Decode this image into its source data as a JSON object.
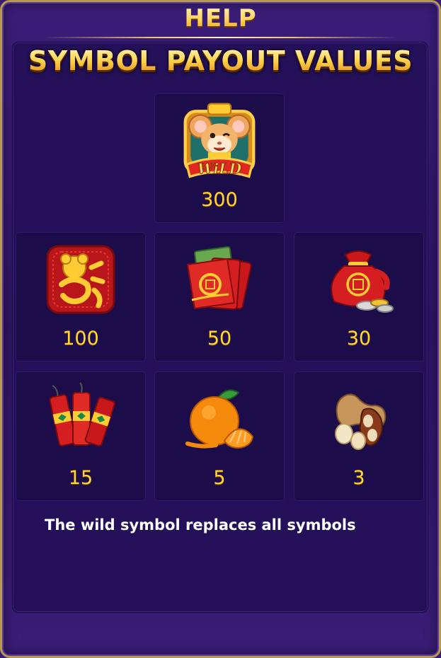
{
  "header": {
    "title": "HELP"
  },
  "main": {
    "page_title": "SYMBOL PAYOUT VALUES",
    "symbols": [
      {
        "icon": "wild-mouse-icon",
        "badge": "WiLD",
        "payout": "300"
      },
      {
        "icon": "fortune-charm-icon",
        "payout": "100"
      },
      {
        "icon": "red-envelope-icon",
        "payout": "50"
      },
      {
        "icon": "money-bag-icon",
        "payout": "30"
      },
      {
        "icon": "firecracker-icon",
        "payout": "15"
      },
      {
        "icon": "orange-icon",
        "payout": "5"
      },
      {
        "icon": "peanut-icon",
        "payout": "3"
      }
    ],
    "rule_text": "The wild symbol replaces all symbols"
  },
  "colors": {
    "gold": "#ffd633",
    "background": "#2e1465",
    "cell": "#1d0c4a",
    "frame": "#b89a52"
  }
}
